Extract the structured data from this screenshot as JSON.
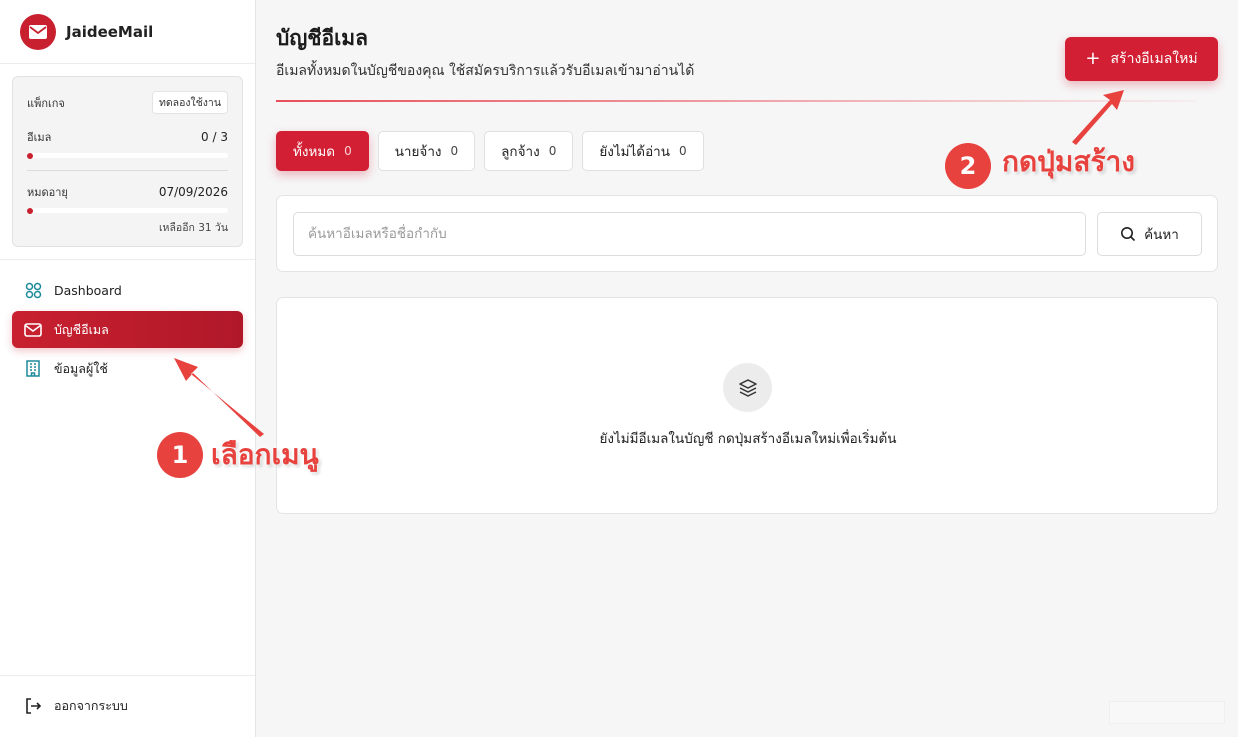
{
  "brand": {
    "name": "JaideeMail"
  },
  "package": {
    "label": "แพ็กเกจ",
    "badge": "ทดลองใช้งาน",
    "email_label": "อีเมล",
    "email_value": "0 / 3",
    "email_usage_fraction": 0,
    "expire_label": "หมดอายุ",
    "expire_value": "07/09/2026",
    "remaining": "เหลืออีก 31 วัน"
  },
  "nav": {
    "items": [
      {
        "label": "Dashboard",
        "icon": "dashboard-icon"
      },
      {
        "label": "บัญชีอีเมล",
        "icon": "mail-icon",
        "active": true
      },
      {
        "label": "ข้อมูลผู้ใช้",
        "icon": "building-icon"
      }
    ],
    "logout": "ออกจากระบบ"
  },
  "header": {
    "title": "บัญชีอีเมล",
    "subtitle": "อีเมลทั้งหมดในบัญชีของคุณ ใช้สมัครบริการแล้วรับอีเมลเข้ามาอ่านได้",
    "create_label": "สร้างอีเมลใหม่"
  },
  "tabs": [
    {
      "label": "ทั้งหมด",
      "count": "0",
      "active": true
    },
    {
      "label": "นายจ้าง",
      "count": "0"
    },
    {
      "label": "ลูกจ้าง",
      "count": "0"
    },
    {
      "label": "ยังไม่ได้อ่าน",
      "count": "0"
    }
  ],
  "search": {
    "placeholder": "ค้นหาอีเมลหรือชื่อกำกับ",
    "value": "",
    "button_label": "ค้นหา"
  },
  "empty": {
    "message": "ยังไม่มีอีเมลในบัญชี กดปุ่มสร้างอีเมลใหม่เพื่อเริ่มต้น"
  },
  "callouts": [
    {
      "number": "1",
      "text": "เลือกเมนู"
    },
    {
      "number": "2",
      "text": "กดปุ่มสร้าง"
    }
  ],
  "colors": {
    "accent": "#d21f33",
    "callout": "#e8423f"
  }
}
